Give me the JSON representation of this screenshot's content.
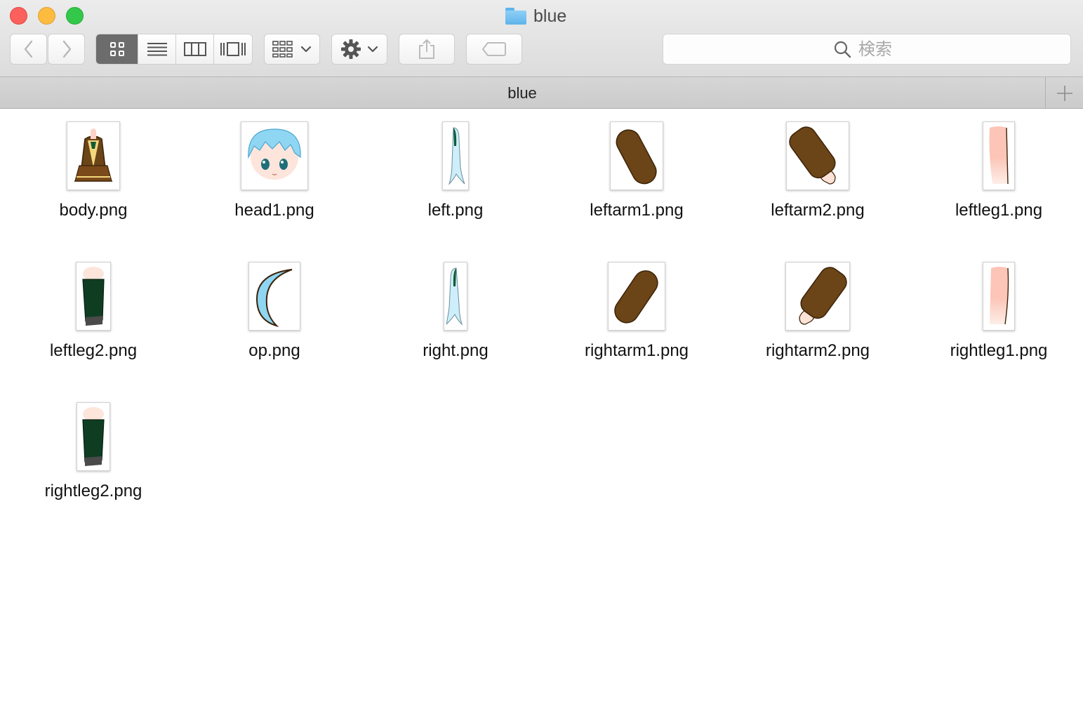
{
  "window": {
    "title": "blue"
  },
  "toolbar": {
    "back_icon": "chevron-left-icon",
    "forward_icon": "chevron-right-icon",
    "view_modes": [
      "icon-view",
      "list-view",
      "column-view",
      "cover-flow-view"
    ],
    "active_view": "icon-view",
    "arrange_icon": "grid-arrange-icon",
    "action_icon": "gear-icon",
    "share_icon": "share-icon",
    "tag_icon": "tag-icon",
    "search_placeholder": "検索"
  },
  "tabbar": {
    "label": "blue",
    "add_icon": "plus-icon"
  },
  "files": [
    {
      "name": "body.png",
      "thumb": "body"
    },
    {
      "name": "head1.png",
      "thumb": "head"
    },
    {
      "name": "left.png",
      "thumb": "hair-strand"
    },
    {
      "name": "leftarm1.png",
      "thumb": "arm-sleeve"
    },
    {
      "name": "leftarm2.png",
      "thumb": "arm-sleeve-hand"
    },
    {
      "name": "leftleg1.png",
      "thumb": "leg-skin"
    },
    {
      "name": "leftleg2.png",
      "thumb": "leg-stocking"
    },
    {
      "name": "op.png",
      "thumb": "hair-crescent"
    },
    {
      "name": "right.png",
      "thumb": "hair-strand"
    },
    {
      "name": "rightarm1.png",
      "thumb": "arm-sleeve"
    },
    {
      "name": "rightarm2.png",
      "thumb": "arm-sleeve-hand"
    },
    {
      "name": "rightleg1.png",
      "thumb": "leg-skin"
    },
    {
      "name": "rightleg2.png",
      "thumb": "leg-stocking"
    }
  ],
  "colors": {
    "sleeve": "#6b4417",
    "skin": "#fdd3c8",
    "stocking": "#0f3d22",
    "hair": "#8fd6f2",
    "close": "#fc605c",
    "minimize": "#fdbc40",
    "maximize": "#34c84a"
  }
}
